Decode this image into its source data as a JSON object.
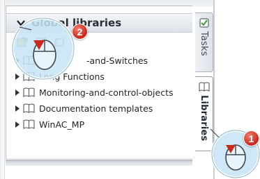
{
  "panel": {
    "section_title": "Global libraries",
    "tree_items": [
      {
        "label": "-and-Switches"
      },
      {
        "label": "Long Functions"
      },
      {
        "label": "Monitoring-and-control-objects"
      },
      {
        "label": "Documentation templates"
      },
      {
        "label": "WinAC_MP"
      }
    ]
  },
  "side_tabs": [
    {
      "label": "Tasks",
      "icon": "tasks-icon",
      "active": false
    },
    {
      "label": "Libraries",
      "icon": "book-icon",
      "active": true
    }
  ],
  "callouts": [
    {
      "number": "1",
      "target": "Libraries tab"
    },
    {
      "number": "2",
      "target": "Global libraries collapse arrow"
    }
  ],
  "colors": {
    "accent_red": "#c9281b",
    "callout_blue": "#c6e4f6",
    "border": "#b5bcc4"
  }
}
